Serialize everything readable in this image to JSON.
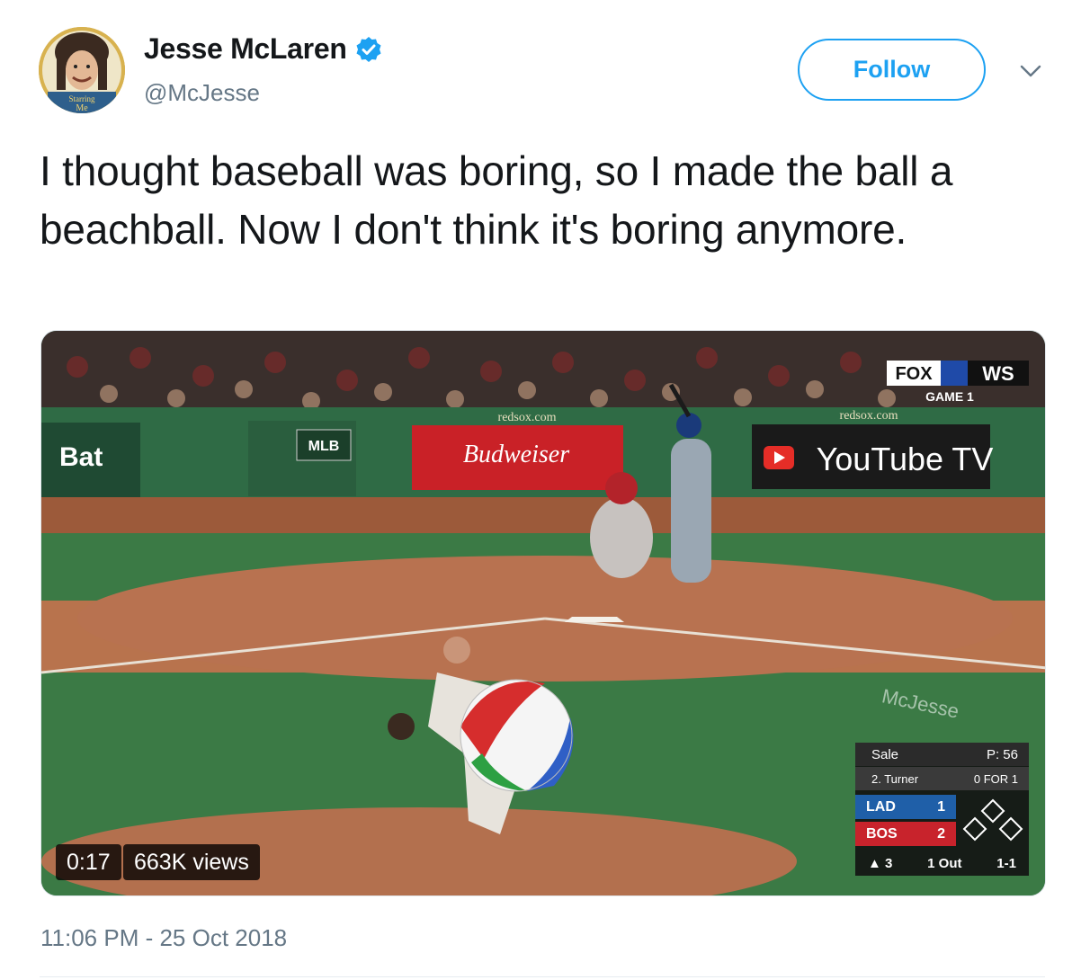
{
  "user": {
    "display_name": "Jesse McLaren",
    "handle": "@McJesse",
    "verified": true,
    "avatar_caption": "Starring Me"
  },
  "follow_label": "Follow",
  "tweet": {
    "text": "I thought baseball was boring, so I made the ball a beachball. Now I don't think it's boring anymore.",
    "timestamp": "11:06 PM - 25 Oct 2018"
  },
  "video": {
    "duration": "0:17",
    "views": "663K views",
    "watermark": "McJesse",
    "broadcast": {
      "network": "FOX",
      "series": "WS",
      "game": "GAME 1",
      "ads": [
        "redsox.com",
        "Budweiser",
        "YouTube TV",
        "MLB",
        "Bat"
      ]
    },
    "scoreboard": {
      "pitcher": "Sale",
      "pitch_count": "P: 56",
      "batter": "2. Turner",
      "batter_stats": "0 FOR 1",
      "away_team": "LAD",
      "away_score": "1",
      "home_team": "BOS",
      "home_score": "2",
      "inning": "▲ 3",
      "outs": "1 Out",
      "count": "1-1"
    }
  },
  "colors": {
    "brand": "#1da1f2",
    "text": "#14171a",
    "secondary": "#657786"
  }
}
